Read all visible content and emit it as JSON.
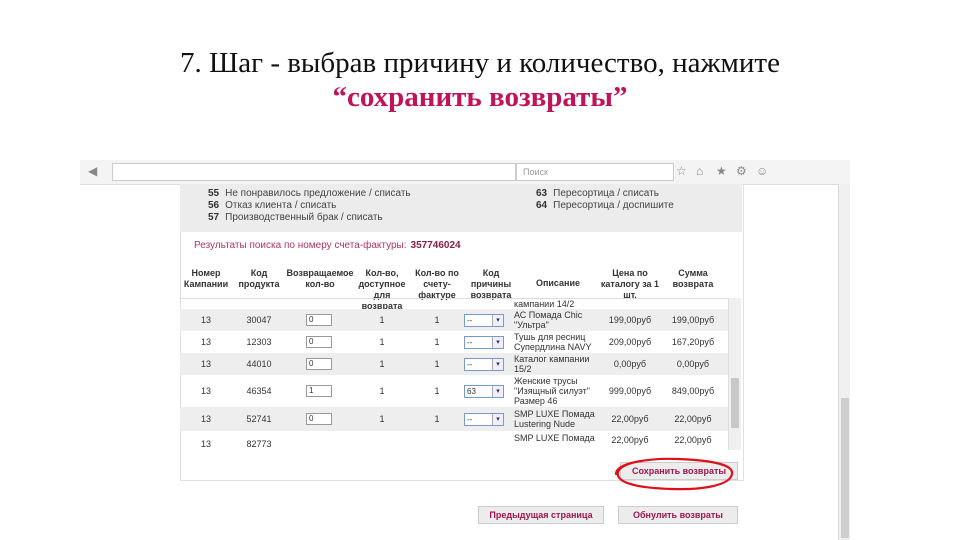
{
  "slide": {
    "title_line1": "7. Шаг -  выбрав причину и количество, нажмите",
    "title_line2": "“сохранить возвраты”"
  },
  "browser": {
    "address": "",
    "search_placeholder": "Поиск"
  },
  "reasons": [
    {
      "code": "55",
      "text": "Не понравилось предложение / списать"
    },
    {
      "code": "56",
      "text": "Отказ клиента / списать"
    },
    {
      "code": "57",
      "text": "Производственный брак / списать"
    },
    {
      "code": "63",
      "text": "Пересортица / списать"
    },
    {
      "code": "64",
      "text": "Пересортица / доспишите"
    }
  ],
  "results": {
    "label": "Результаты поиска по номеру счета-фактуры:",
    "invoice_number": "357746024"
  },
  "table": {
    "headers": [
      "Номер Кампании",
      "Код продукта",
      "Возвращаемое кол-во",
      "Кол-во, доступное для возврата",
      "Кол-во по счету-фактуре",
      "Код причины возврата",
      "Описание",
      "Цена по каталогу за 1 шт.",
      "Сумма возврата"
    ],
    "rows": [
      {
        "campaign": "13",
        "code": "30047",
        "qty": "0",
        "available": "1",
        "invoiced": "1",
        "reason": "--",
        "description": "АС Помада Chic \"Ультра\"",
        "price": "199,00руб",
        "sum": "199,00руб"
      },
      {
        "campaign": "13",
        "code": "12303",
        "qty": "0",
        "available": "1",
        "invoiced": "1",
        "reason": "--",
        "description": "Тушь для ресниц Супердлина NAVY",
        "price": "209,00руб",
        "sum": "167,20руб"
      },
      {
        "campaign": "13",
        "code": "44010",
        "qty": "0",
        "available": "1",
        "invoiced": "1",
        "reason": "--",
        "description": "Каталог кампании 15/2",
        "price": "0,00руб",
        "sum": "0,00руб"
      },
      {
        "campaign": "13",
        "code": "46354",
        "qty": "1",
        "available": "1",
        "invoiced": "1",
        "reason": "63",
        "description": "Женские трусы \"Изящный силуэт\" Размер 46",
        "price": "999,00руб",
        "sum": "849,00руб"
      },
      {
        "campaign": "13",
        "code": "52741",
        "qty": "0",
        "available": "1",
        "invoiced": "1",
        "reason": "--",
        "description": "SMP LUXE Помада Lustering Nude",
        "price": "22,00руб",
        "sum": "22,00руб"
      },
      {
        "campaign": "13",
        "code": "82773",
        "qty": "",
        "available": "",
        "invoiced": "",
        "reason": "",
        "description": "SMP LUXE Помада",
        "price": "22,00руб",
        "sum": "22,00руб"
      }
    ],
    "partial_top_description": "кампании 14/2"
  },
  "buttons": {
    "save": "Сохранить возвраты",
    "previous": "Предыдущая страница",
    "clear": "Обнулить возвраты"
  },
  "colors": {
    "accent": "#a01550",
    "title_accent": "#c0135a",
    "highlight_circle": "#e0101a"
  }
}
